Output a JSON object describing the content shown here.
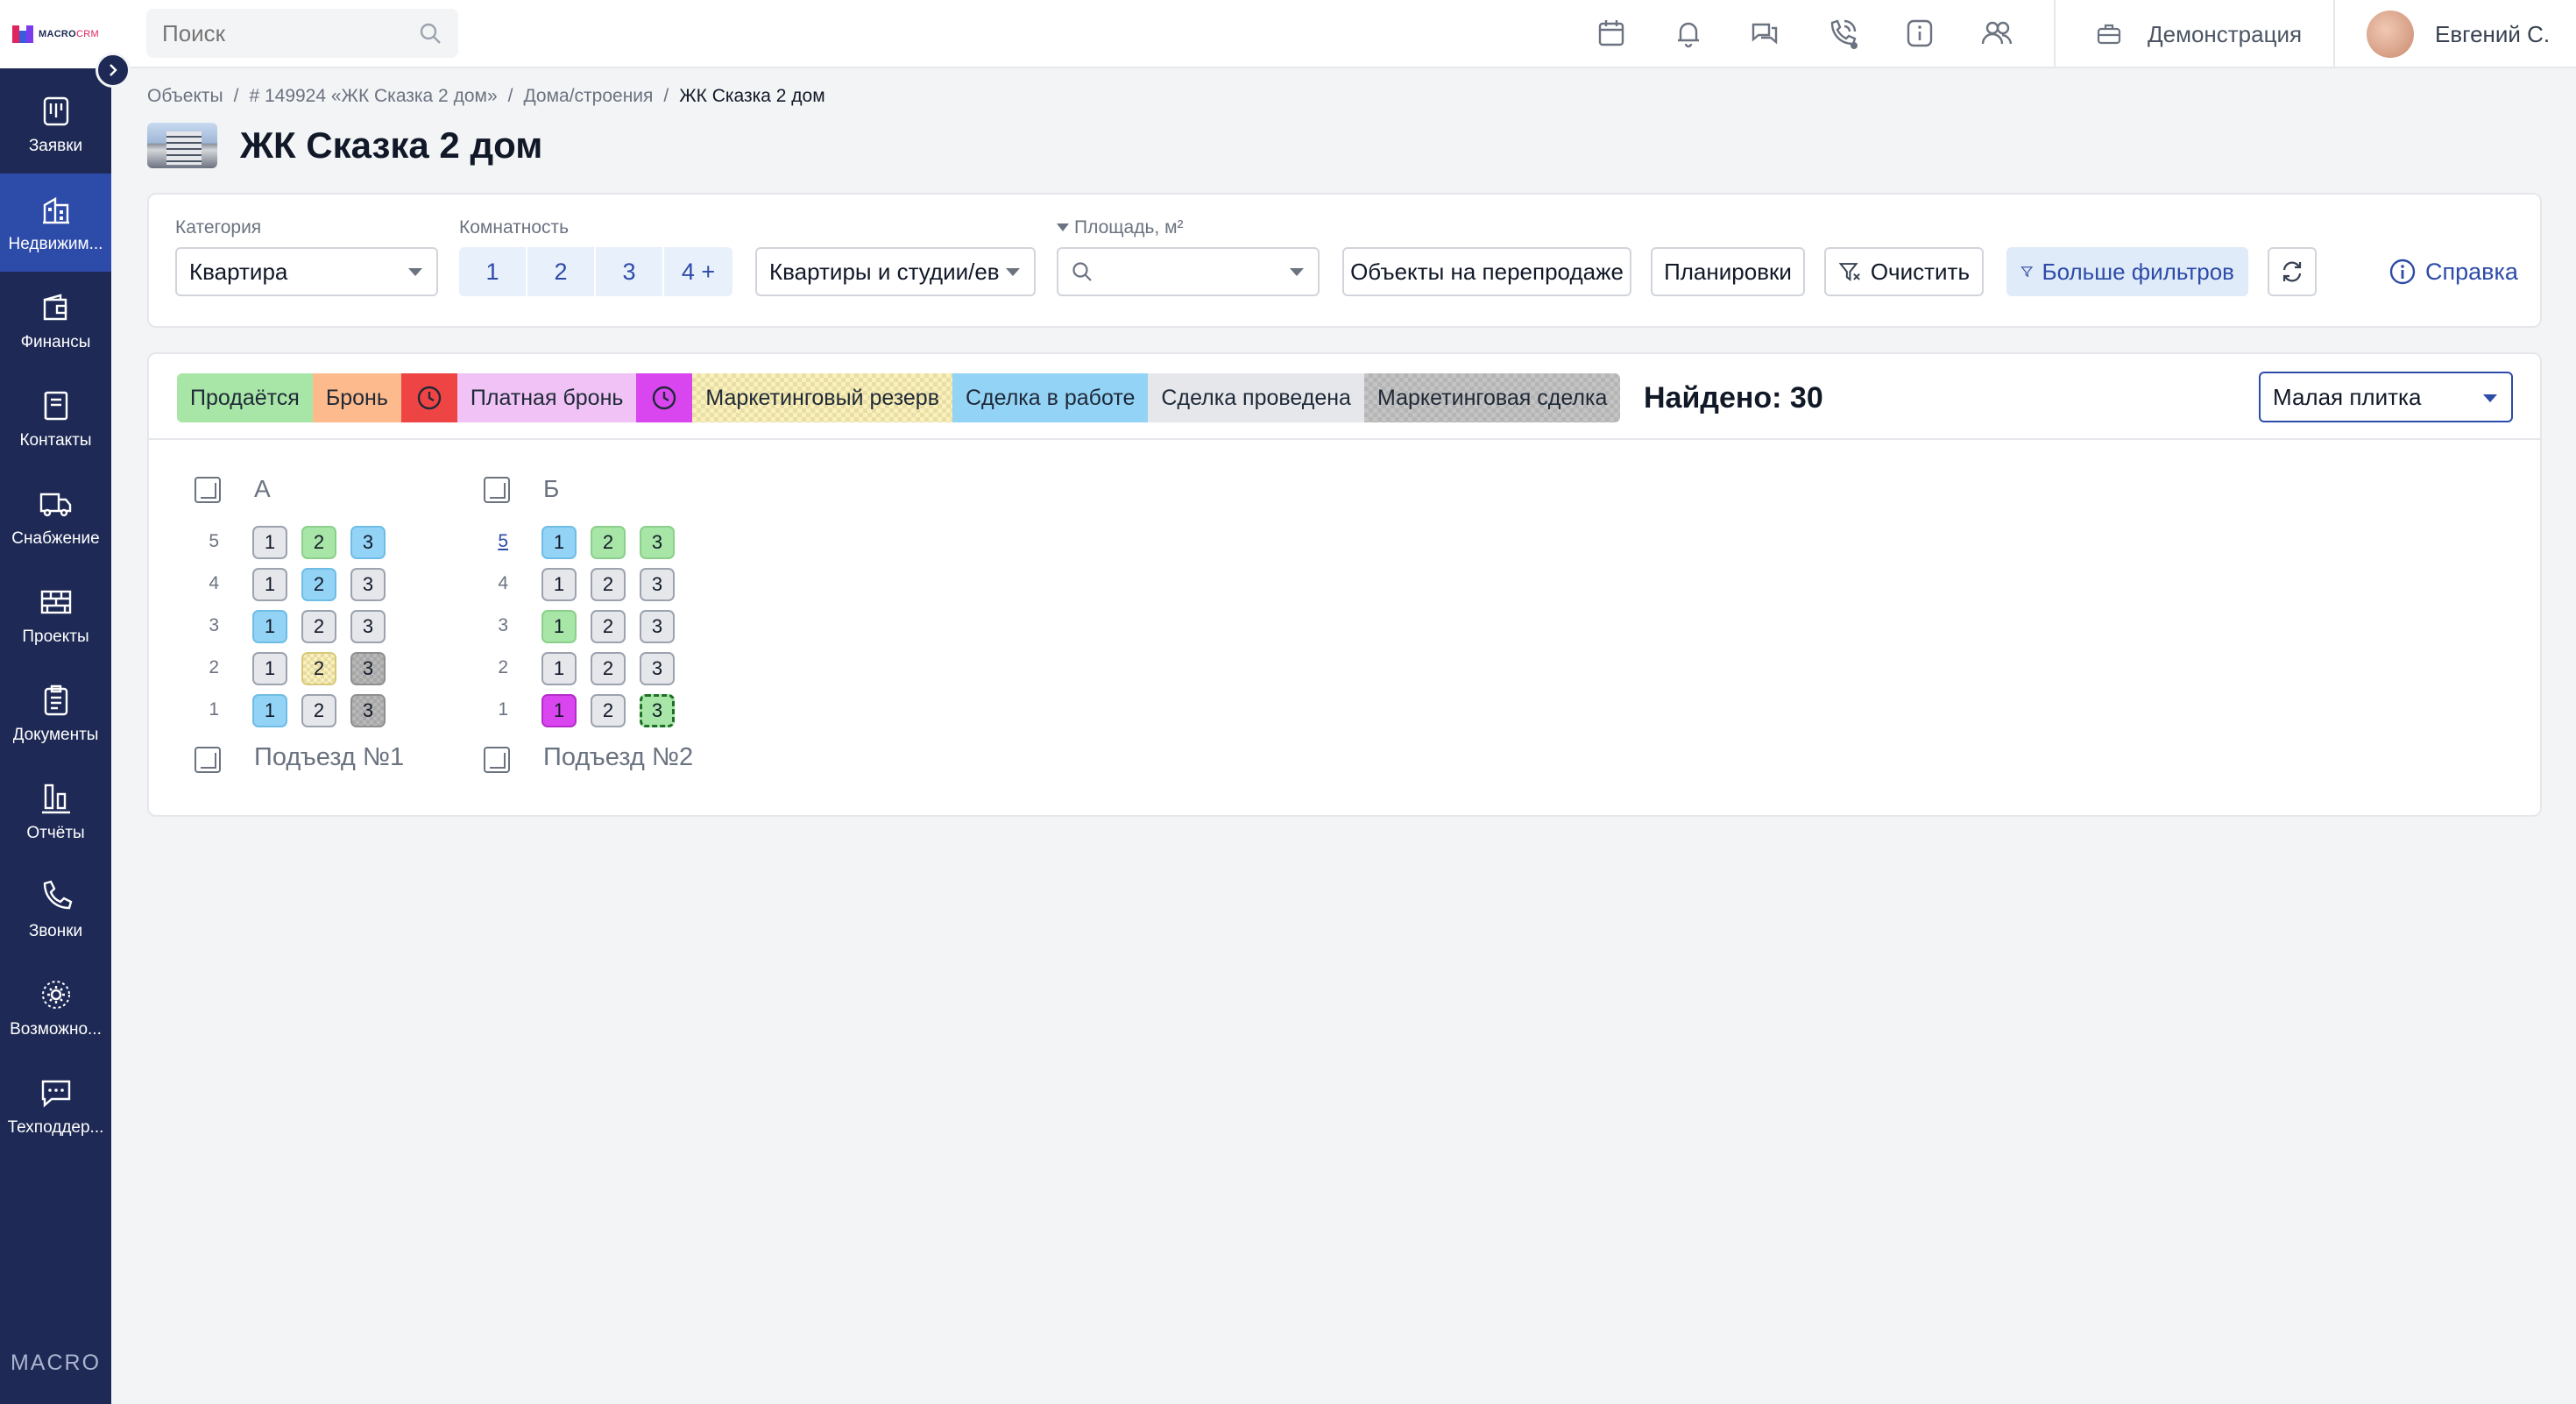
{
  "app": {
    "logo_text": "MACRO",
    "logo_text_accent": "CRM",
    "footer_brand": "MACRO"
  },
  "sidebar": {
    "items": [
      {
        "label": "Заявки",
        "icon": "requests-icon"
      },
      {
        "label": "Недвижим...",
        "icon": "real-estate-icon",
        "active": true
      },
      {
        "label": "Финансы",
        "icon": "wallet-icon"
      },
      {
        "label": "Контакты",
        "icon": "contacts-icon"
      },
      {
        "label": "Снабжение",
        "icon": "truck-icon"
      },
      {
        "label": "Проекты",
        "icon": "bricks-icon"
      },
      {
        "label": "Документы",
        "icon": "clipboard-icon"
      },
      {
        "label": "Отчёты",
        "icon": "bar-chart-icon"
      },
      {
        "label": "Звонки",
        "icon": "phone-icon"
      },
      {
        "label": "Возможно...",
        "icon": "gear-icon"
      },
      {
        "label": "Техподдер...",
        "icon": "support-chat-icon"
      }
    ]
  },
  "topbar": {
    "search_placeholder": "Поиск",
    "icons": [
      "calendar-icon",
      "bell-icon",
      "chat-icon",
      "phone-call-icon",
      "info-icon",
      "users-icon"
    ],
    "demo_label": "Демонстрация",
    "user_name": "Евгений С."
  },
  "breadcrumb": {
    "items": [
      "Объекты",
      "# 149924 «ЖК Сказка 2 дом»",
      "Дома/строения"
    ],
    "current": "ЖК Сказка 2 дом",
    "separator": "/"
  },
  "page": {
    "title": "ЖК Сказка 2 дом"
  },
  "filters": {
    "category_label": "Категория",
    "category_value": "Квартира",
    "rooms_label": "Комнатность",
    "rooms": [
      "1",
      "2",
      "3",
      "4 +"
    ],
    "type_value": "Квартиры и студии/ев",
    "area_label": "Площадь, м²",
    "area_value": "",
    "resale_button": "Объекты на перепродаже",
    "plans_button": "Планировки",
    "clear_button": "Очистить",
    "more_filters_button": "Больше фильтров",
    "help_link": "Справка"
  },
  "statuses": {
    "legend": [
      {
        "label": "Продаётся",
        "color": "#a7e6a7"
      },
      {
        "label": "Бронь",
        "color": "#fdba8c"
      },
      {
        "label": "",
        "color": "#ef4444",
        "icon": "clock-icon"
      },
      {
        "label": "Платная бронь",
        "color": "#f0c2f5"
      },
      {
        "label": "",
        "color": "#d946ef",
        "icon": "clock-icon"
      },
      {
        "label": "Маркетинговый резерв",
        "color": "#fbf1b8",
        "pattern": "checker"
      },
      {
        "label": "Сделка в работе",
        "color": "#93d3f5"
      },
      {
        "label": "Сделка проведена",
        "color": "#e5e7eb"
      },
      {
        "label": "Маркетинговая сделка",
        "color": "#c4c4c4",
        "pattern": "checker"
      }
    ],
    "found_label": "Найдено: 30",
    "view_value": "Малая плитка"
  },
  "chessboard": {
    "sections": [
      {
        "letter": "А",
        "entrance": "Подъезд №1",
        "floors": [
          {
            "floor": "5",
            "link": false,
            "apts": [
              {
                "n": "1",
                "s": "done"
              },
              {
                "n": "2",
                "s": "sale"
              },
              {
                "n": "3",
                "s": "work"
              }
            ]
          },
          {
            "floor": "4",
            "link": false,
            "apts": [
              {
                "n": "1",
                "s": "done"
              },
              {
                "n": "2",
                "s": "work"
              },
              {
                "n": "3",
                "s": "done"
              }
            ]
          },
          {
            "floor": "3",
            "link": false,
            "apts": [
              {
                "n": "1",
                "s": "work"
              },
              {
                "n": "2",
                "s": "done"
              },
              {
                "n": "3",
                "s": "done"
              }
            ]
          },
          {
            "floor": "2",
            "link": false,
            "apts": [
              {
                "n": "1",
                "s": "done"
              },
              {
                "n": "2",
                "s": "reserve"
              },
              {
                "n": "3",
                "s": "mdeal"
              }
            ]
          },
          {
            "floor": "1",
            "link": false,
            "apts": [
              {
                "n": "1",
                "s": "work"
              },
              {
                "n": "2",
                "s": "done"
              },
              {
                "n": "3",
                "s": "mdeal"
              }
            ]
          }
        ]
      },
      {
        "letter": "Б",
        "entrance": "Подъезд №2",
        "floors": [
          {
            "floor": "5",
            "link": true,
            "apts": [
              {
                "n": "1",
                "s": "work"
              },
              {
                "n": "2",
                "s": "sale"
              },
              {
                "n": "3",
                "s": "sale"
              }
            ]
          },
          {
            "floor": "4",
            "link": false,
            "apts": [
              {
                "n": "1",
                "s": "done"
              },
              {
                "n": "2",
                "s": "done"
              },
              {
                "n": "3",
                "s": "done"
              }
            ]
          },
          {
            "floor": "3",
            "link": false,
            "apts": [
              {
                "n": "1",
                "s": "sale"
              },
              {
                "n": "2",
                "s": "done"
              },
              {
                "n": "3",
                "s": "done"
              }
            ]
          },
          {
            "floor": "2",
            "link": false,
            "apts": [
              {
                "n": "1",
                "s": "done"
              },
              {
                "n": "2",
                "s": "done"
              },
              {
                "n": "3",
                "s": "done"
              }
            ]
          },
          {
            "floor": "1",
            "link": false,
            "apts": [
              {
                "n": "1",
                "s": "paid"
              },
              {
                "n": "2",
                "s": "done"
              },
              {
                "n": "3",
                "s": "selected"
              }
            ]
          }
        ]
      }
    ]
  },
  "colors": {
    "sidebar": "#1e2a55",
    "sidebar_active": "#2d4ba8",
    "accent": "#2d4ba8"
  }
}
